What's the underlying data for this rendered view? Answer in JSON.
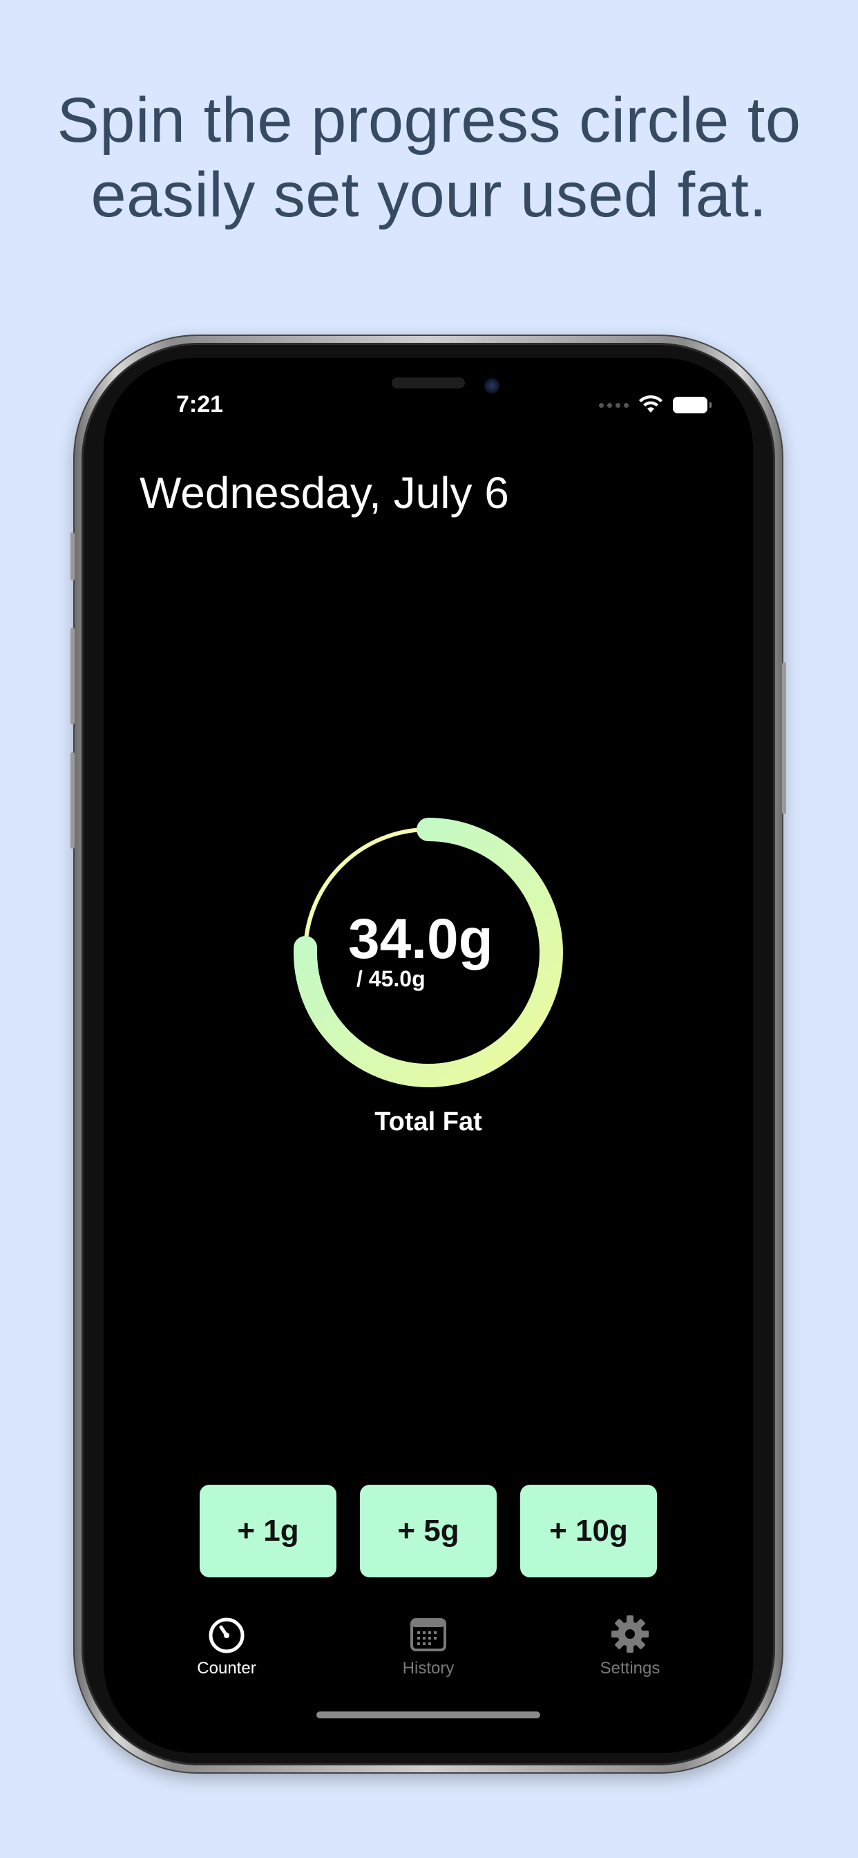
{
  "headline": {
    "line1": "Spin the progress circle to",
    "line2": "easily set your used fat."
  },
  "status_bar": {
    "time": "7:21",
    "icons": [
      "signal-dots-icon",
      "wifi-icon",
      "battery-icon"
    ]
  },
  "screen": {
    "date": "Wednesday, July 6",
    "progress": {
      "value": "34.0g",
      "goal": "/ 45.0g",
      "label": "Total Fat",
      "fraction": 0.756,
      "gradient_start": "#b9f8d2",
      "gradient_end": "#eefb9c"
    },
    "quick_add": [
      {
        "label": "+ 1g"
      },
      {
        "label": "+ 5g"
      },
      {
        "label": "+ 10g"
      }
    ],
    "tabs": [
      {
        "label": "Counter",
        "icon": "gauge-icon",
        "active": true
      },
      {
        "label": "History",
        "icon": "calendar-icon",
        "active": false
      },
      {
        "label": "Settings",
        "icon": "gear-icon",
        "active": false
      }
    ],
    "colors": {
      "background": "#000000",
      "button": "#b7fbd5",
      "tab_active": "#ffffff",
      "tab_inactive": "#7a7a7a",
      "page_background": "#d9e6fd",
      "headline": "#374a63"
    }
  }
}
